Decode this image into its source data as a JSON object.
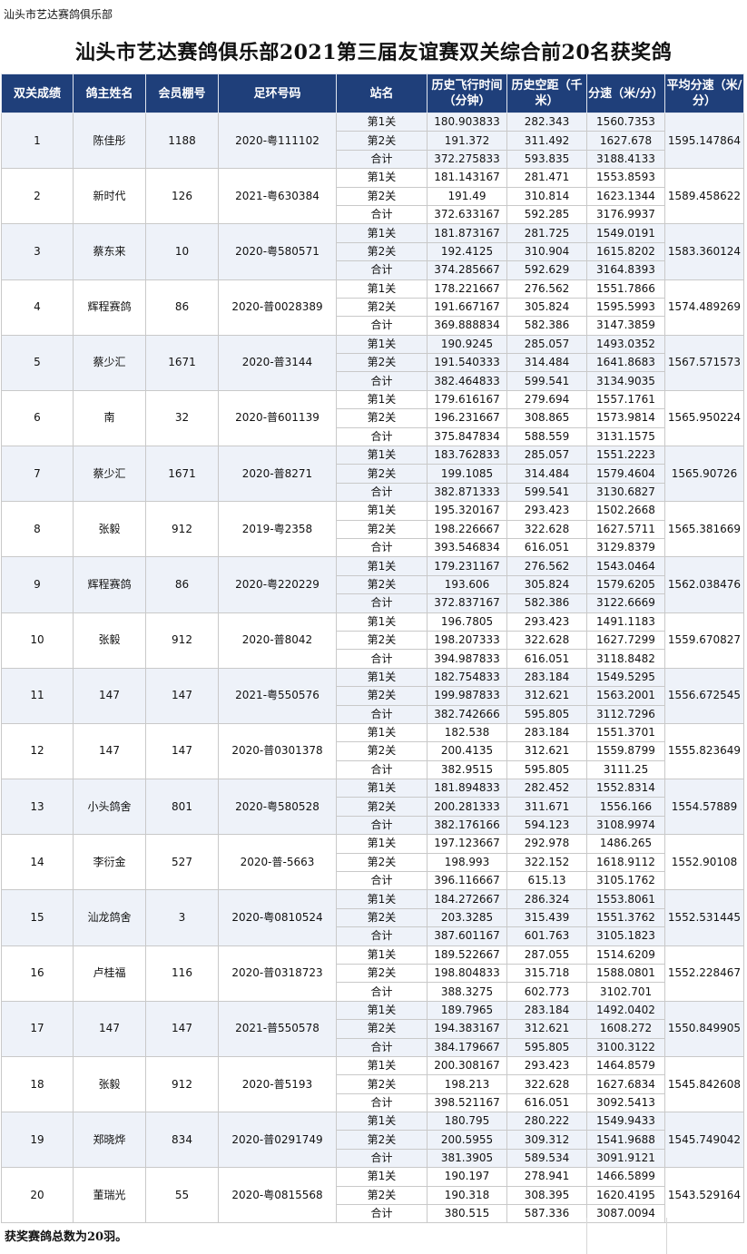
{
  "org_label": "汕头市艺达赛鸽俱乐部",
  "title": "汕头市艺达赛鸽俱乐部2021第三届友谊赛双关综合前20名获奖鸽",
  "headers": [
    "双关成绩",
    "鸽主姓名",
    "会员棚号",
    "足环号码",
    "站名",
    "历史飞行时间（分钟）",
    "历史空距（千米）",
    "分速（米/分）",
    "平均分速（米/分）"
  ],
  "stage_labels": [
    "第1关",
    "第2关",
    "合计"
  ],
  "rows": [
    {
      "rank": "1",
      "owner": "陈佳彤",
      "member": "1188",
      "ring": "2020-粤111102",
      "stages": [
        [
          "180.903833",
          "282.343",
          "1560.7353"
        ],
        [
          "191.372",
          "311.492",
          "1627.678"
        ],
        [
          "372.275833",
          "593.835",
          "3188.4133"
        ]
      ],
      "avg": "1595.147864"
    },
    {
      "rank": "2",
      "owner": "新时代",
      "member": "126",
      "ring": "2021-粤630384",
      "stages": [
        [
          "181.143167",
          "281.471",
          "1553.8593"
        ],
        [
          "191.49",
          "310.814",
          "1623.1344"
        ],
        [
          "372.633167",
          "592.285",
          "3176.9937"
        ]
      ],
      "avg": "1589.458622"
    },
    {
      "rank": "3",
      "owner": "蔡东来",
      "member": "10",
      "ring": "2020-粤580571",
      "stages": [
        [
          "181.873167",
          "281.725",
          "1549.0191"
        ],
        [
          "192.4125",
          "310.904",
          "1615.8202"
        ],
        [
          "374.285667",
          "592.629",
          "3164.8393"
        ]
      ],
      "avg": "1583.360124"
    },
    {
      "rank": "4",
      "owner": "辉程赛鸽",
      "member": "86",
      "ring": "2020-普0028389",
      "stages": [
        [
          "178.221667",
          "276.562",
          "1551.7866"
        ],
        [
          "191.667167",
          "305.824",
          "1595.5993"
        ],
        [
          "369.888834",
          "582.386",
          "3147.3859"
        ]
      ],
      "avg": "1574.489269"
    },
    {
      "rank": "5",
      "owner": "蔡少汇",
      "member": "1671",
      "ring": "2020-普3144",
      "stages": [
        [
          "190.9245",
          "285.057",
          "1493.0352"
        ],
        [
          "191.540333",
          "314.484",
          "1641.8683"
        ],
        [
          "382.464833",
          "599.541",
          "3134.9035"
        ]
      ],
      "avg": "1567.571573"
    },
    {
      "rank": "6",
      "owner": "南",
      "member": "32",
      "ring": "2020-普601139",
      "stages": [
        [
          "179.616167",
          "279.694",
          "1557.1761"
        ],
        [
          "196.231667",
          "308.865",
          "1573.9814"
        ],
        [
          "375.847834",
          "588.559",
          "3131.1575"
        ]
      ],
      "avg": "1565.950224"
    },
    {
      "rank": "7",
      "owner": "蔡少汇",
      "member": "1671",
      "ring": "2020-普8271",
      "stages": [
        [
          "183.762833",
          "285.057",
          "1551.2223"
        ],
        [
          "199.1085",
          "314.484",
          "1579.4604"
        ],
        [
          "382.871333",
          "599.541",
          "3130.6827"
        ]
      ],
      "avg": "1565.90726"
    },
    {
      "rank": "8",
      "owner": "张毅",
      "member": "912",
      "ring": "2019-粤2358",
      "stages": [
        [
          "195.320167",
          "293.423",
          "1502.2668"
        ],
        [
          "198.226667",
          "322.628",
          "1627.5711"
        ],
        [
          "393.546834",
          "616.051",
          "3129.8379"
        ]
      ],
      "avg": "1565.381669"
    },
    {
      "rank": "9",
      "owner": "辉程赛鸽",
      "member": "86",
      "ring": "2020-粤220229",
      "stages": [
        [
          "179.231167",
          "276.562",
          "1543.0464"
        ],
        [
          "193.606",
          "305.824",
          "1579.6205"
        ],
        [
          "372.837167",
          "582.386",
          "3122.6669"
        ]
      ],
      "avg": "1562.038476"
    },
    {
      "rank": "10",
      "owner": "张毅",
      "member": "912",
      "ring": "2020-普8042",
      "stages": [
        [
          "196.7805",
          "293.423",
          "1491.1183"
        ],
        [
          "198.207333",
          "322.628",
          "1627.7299"
        ],
        [
          "394.987833",
          "616.051",
          "3118.8482"
        ]
      ],
      "avg": "1559.670827"
    },
    {
      "rank": "11",
      "owner": "147",
      "member": "147",
      "ring": "2021-粤550576",
      "stages": [
        [
          "182.754833",
          "283.184",
          "1549.5295"
        ],
        [
          "199.987833",
          "312.621",
          "1563.2001"
        ],
        [
          "382.742666",
          "595.805",
          "3112.7296"
        ]
      ],
      "avg": "1556.672545"
    },
    {
      "rank": "12",
      "owner": "147",
      "member": "147",
      "ring": "2020-普0301378",
      "stages": [
        [
          "182.538",
          "283.184",
          "1551.3701"
        ],
        [
          "200.4135",
          "312.621",
          "1559.8799"
        ],
        [
          "382.9515",
          "595.805",
          "3111.25"
        ]
      ],
      "avg": "1555.823649"
    },
    {
      "rank": "13",
      "owner": "小头鸽舍",
      "member": "801",
      "ring": "2020-粤580528",
      "stages": [
        [
          "181.894833",
          "282.452",
          "1552.8314"
        ],
        [
          "200.281333",
          "311.671",
          "1556.166"
        ],
        [
          "382.176166",
          "594.123",
          "3108.9974"
        ]
      ],
      "avg": "1554.57889"
    },
    {
      "rank": "14",
      "owner": "李衍金",
      "member": "527",
      "ring": "2020-普-5663",
      "stages": [
        [
          "197.123667",
          "292.978",
          "1486.265"
        ],
        [
          "198.993",
          "322.152",
          "1618.9112"
        ],
        [
          "396.116667",
          "615.13",
          "3105.1762"
        ]
      ],
      "avg": "1552.90108"
    },
    {
      "rank": "15",
      "owner": "汕龙鸽舍",
      "member": "3",
      "ring": "2020-粤0810524",
      "stages": [
        [
          "184.272667",
          "286.324",
          "1553.8061"
        ],
        [
          "203.3285",
          "315.439",
          "1551.3762"
        ],
        [
          "387.601167",
          "601.763",
          "3105.1823"
        ]
      ],
      "avg": "1552.531445"
    },
    {
      "rank": "16",
      "owner": "卢桂福",
      "member": "116",
      "ring": "2020-普0318723",
      "stages": [
        [
          "189.522667",
          "287.055",
          "1514.6209"
        ],
        [
          "198.804833",
          "315.718",
          "1588.0801"
        ],
        [
          "388.3275",
          "602.773",
          "3102.701"
        ]
      ],
      "avg": "1552.228467"
    },
    {
      "rank": "17",
      "owner": "147",
      "member": "147",
      "ring": "2021-普550578",
      "stages": [
        [
          "189.7965",
          "283.184",
          "1492.0402"
        ],
        [
          "194.383167",
          "312.621",
          "1608.272"
        ],
        [
          "384.179667",
          "595.805",
          "3100.3122"
        ]
      ],
      "avg": "1550.849905"
    },
    {
      "rank": "18",
      "owner": "张毅",
      "member": "912",
      "ring": "2020-普5193",
      "stages": [
        [
          "200.308167",
          "293.423",
          "1464.8579"
        ],
        [
          "198.213",
          "322.628",
          "1627.6834"
        ],
        [
          "398.521167",
          "616.051",
          "3092.5413"
        ]
      ],
      "avg": "1545.842608"
    },
    {
      "rank": "19",
      "owner": "郑晓烨",
      "member": "834",
      "ring": "2020-普0291749",
      "stages": [
        [
          "180.795",
          "280.222",
          "1549.9433"
        ],
        [
          "200.5955",
          "309.312",
          "1541.9688"
        ],
        [
          "381.3905",
          "589.534",
          "3091.9121"
        ]
      ],
      "avg": "1545.749042"
    },
    {
      "rank": "20",
      "owner": "董瑞光",
      "member": "55",
      "ring": "2020-粤0815568",
      "stages": [
        [
          "190.197",
          "278.941",
          "1466.5899"
        ],
        [
          "190.318",
          "308.395",
          "1620.4195"
        ],
        [
          "380.515",
          "587.336",
          "3087.0094"
        ]
      ],
      "avg": "1543.529164"
    }
  ],
  "footer": "获奖赛鸽总数为20羽。",
  "colors": {
    "header_bg": "#1f3f7a",
    "header_text": "#ffffff",
    "shaded_row": "#eef2f9",
    "border": "#c9c9c9"
  }
}
